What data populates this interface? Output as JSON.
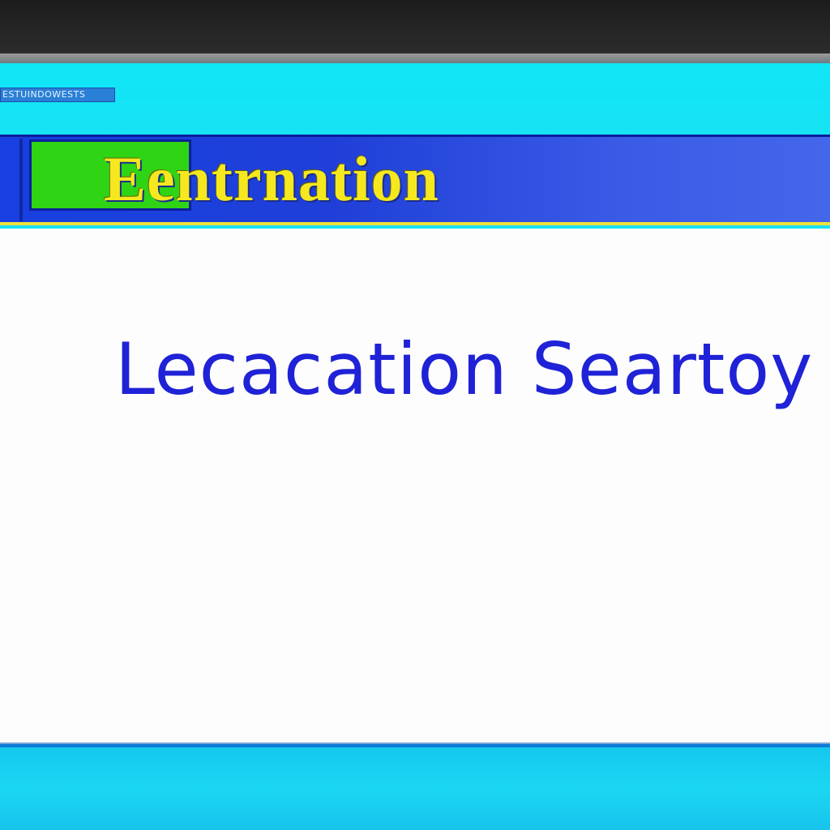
{
  "window": {
    "caption": "ESTUINDOWESTS"
  },
  "banner": {
    "title": "Eentrnation"
  },
  "content": {
    "heading": "Lecacation Seartoy"
  },
  "colors": {
    "window_frame": "#18e2f4",
    "banner_blue": "#1f3fd8",
    "banner_title": "#f5e81e",
    "banner_accent": "#2fd414",
    "heading_text": "#1f22d6",
    "content_bg": "#fdfdfd"
  }
}
